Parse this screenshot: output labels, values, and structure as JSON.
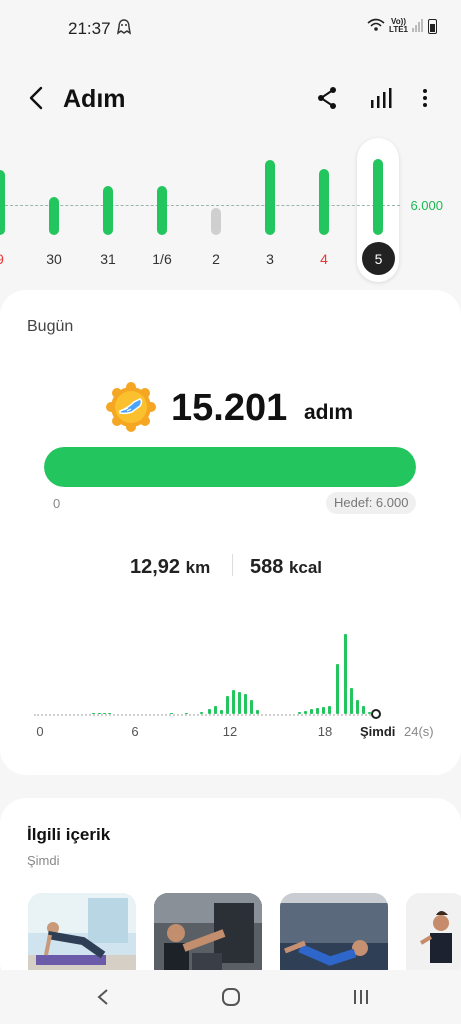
{
  "status_bar": {
    "time": "21:37",
    "lte_top": "Vo))",
    "lte_bottom": "LTE1"
  },
  "header": {
    "title": "Adım"
  },
  "week_chart": {
    "goal_label": "6.000",
    "days": [
      {
        "label": "9",
        "red": true,
        "steps": 13000,
        "grey": false
      },
      {
        "label": "30",
        "red": false,
        "steps": 7700,
        "grey": false
      },
      {
        "label": "31",
        "red": false,
        "steps": 9800,
        "grey": false
      },
      {
        "label": "1/6",
        "red": false,
        "steps": 9800,
        "grey": false
      },
      {
        "label": "2",
        "red": false,
        "steps": 5500,
        "grey": true
      },
      {
        "label": "3",
        "red": false,
        "steps": 15000,
        "grey": false
      },
      {
        "label": "4",
        "red": true,
        "steps": 13300,
        "grey": false
      },
      {
        "label": "5",
        "red": false,
        "steps": 15201,
        "grey": false,
        "selected": true
      }
    ]
  },
  "today": {
    "label": "Bugün",
    "steps": "15.201",
    "unit": "adım",
    "progress_min": "0",
    "goal_text": "Hedef: 6.000",
    "progress_fraction": 1.0,
    "distance_value": "12,92",
    "distance_unit": "km",
    "calories_value": "588",
    "calories_unit": "kcal"
  },
  "hourly_chart": {
    "x_labels": [
      "0",
      "6",
      "12",
      "18"
    ],
    "now_label": "Şimdi",
    "end_label": "24(s)"
  },
  "related": {
    "title": "İlgili içerik",
    "subtitle": "Şimdi"
  },
  "colors": {
    "accent": "#22c55e",
    "weekend": "#e53935"
  }
}
